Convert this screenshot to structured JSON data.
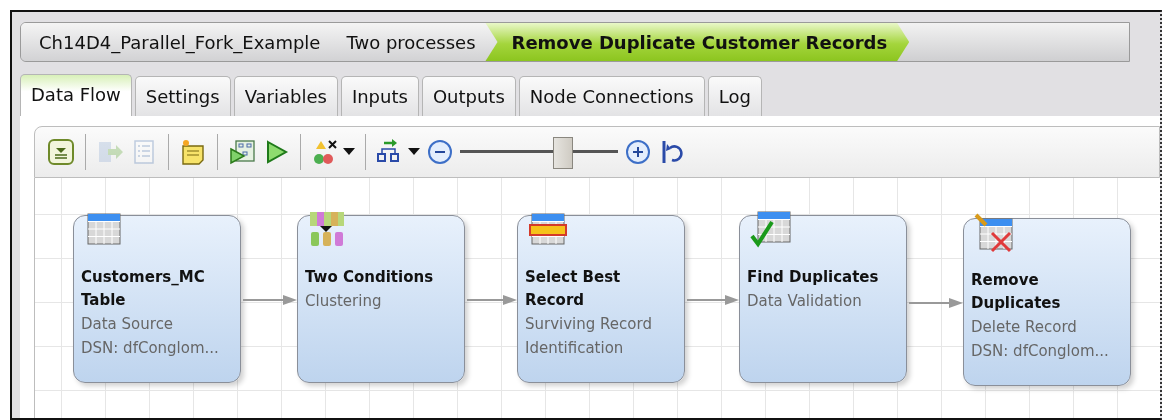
{
  "breadcrumb": [
    {
      "label": "Ch14D4_Parallel_Fork_Example",
      "selected": false
    },
    {
      "label": "Two processes",
      "selected": false
    },
    {
      "label": "Remove Duplicate Customer Records",
      "selected": true
    }
  ],
  "tabs": [
    {
      "label": "Data Flow",
      "selected": true
    },
    {
      "label": "Settings",
      "selected": false
    },
    {
      "label": "Variables",
      "selected": false
    },
    {
      "label": "Inputs",
      "selected": false
    },
    {
      "label": "Outputs",
      "selected": false
    },
    {
      "label": "Node Connections",
      "selected": false
    },
    {
      "label": "Log",
      "selected": false
    }
  ],
  "toolbar": [
    {
      "kind": "collapse",
      "disabled": false
    },
    {
      "kind": "separator"
    },
    {
      "kind": "export",
      "disabled": true
    },
    {
      "kind": "list",
      "disabled": true
    },
    {
      "kind": "separator"
    },
    {
      "kind": "note",
      "disabled": false
    },
    {
      "kind": "separator"
    },
    {
      "kind": "run-step",
      "disabled": false
    },
    {
      "kind": "run",
      "disabled": false
    },
    {
      "kind": "separator"
    },
    {
      "kind": "validate",
      "disabled": false
    },
    {
      "kind": "separator"
    },
    {
      "kind": "layout",
      "disabled": false
    },
    {
      "kind": "zoom-out",
      "disabled": false
    },
    {
      "kind": "slider",
      "level": 0.65
    },
    {
      "kind": "zoom-in",
      "disabled": false
    },
    {
      "kind": "reset",
      "disabled": false
    }
  ],
  "nodes": [
    {
      "kind": "table",
      "title": "Customers_MC Table",
      "details": [
        "Data Source",
        "DSN: dfConglom..."
      ]
    },
    {
      "kind": "cluster",
      "title": "Two Conditions",
      "details": [
        "Clustering"
      ]
    },
    {
      "kind": "select-record",
      "title": "Select Best Record",
      "details": [
        "Surviving Record",
        "Identification"
      ]
    },
    {
      "kind": "check-table",
      "title": "Find Duplicates",
      "details": [
        "Data Validation"
      ]
    },
    {
      "kind": "delete-table",
      "title": "Remove Duplicates",
      "details": [
        "Delete Record",
        "DSN: dfConglom..."
      ]
    }
  ]
}
